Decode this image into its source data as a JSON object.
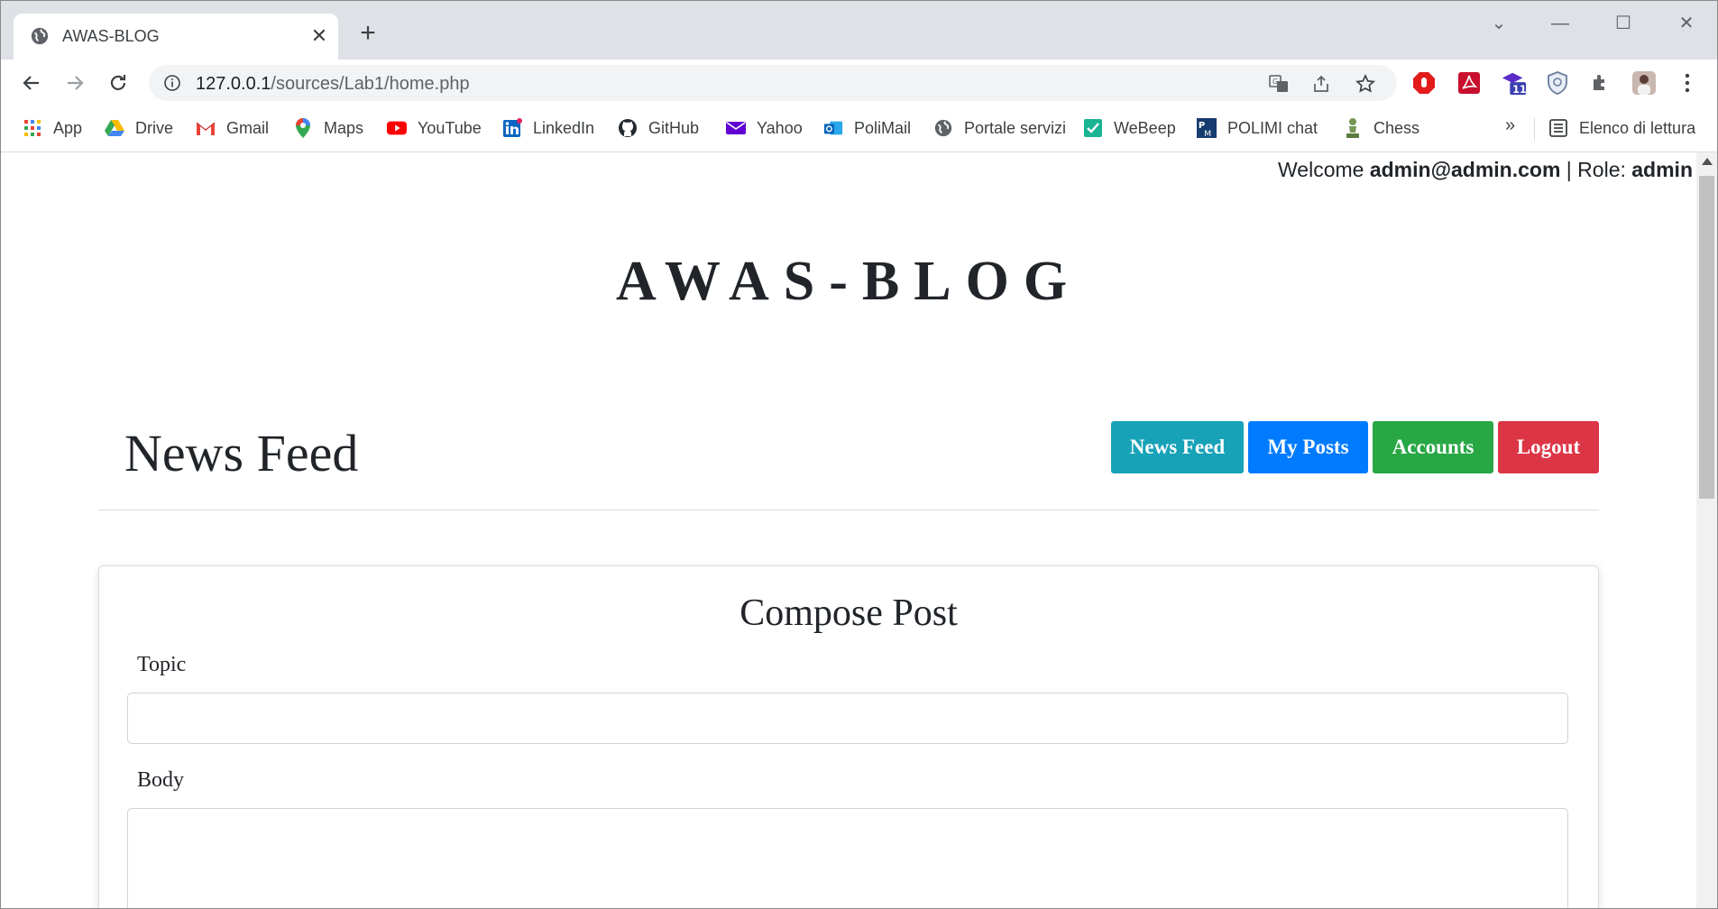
{
  "browser": {
    "tab_title": "AWAS-BLOG",
    "url_host": "127.0.0.1",
    "url_path": "/sources/Lab1/home.php",
    "extension_badge": "11"
  },
  "bookmarks": [
    {
      "label": "App",
      "icon": "apps-grid-icon"
    },
    {
      "label": "Drive",
      "icon": "drive-icon"
    },
    {
      "label": "Gmail",
      "icon": "gmail-icon"
    },
    {
      "label": "Maps",
      "icon": "maps-icon"
    },
    {
      "label": "YouTube",
      "icon": "youtube-icon"
    },
    {
      "label": "LinkedIn",
      "icon": "linkedin-icon"
    },
    {
      "label": "GitHub",
      "icon": "github-icon"
    },
    {
      "label": "Yahoo",
      "icon": "yahoo-icon"
    },
    {
      "label": "PoliMail",
      "icon": "outlook-icon"
    },
    {
      "label": "Portale servizi",
      "icon": "globe-icon"
    },
    {
      "label": "WeBeep",
      "icon": "webeep-icon"
    },
    {
      "label": "POLIMI chat",
      "icon": "polimi-icon"
    },
    {
      "label": "Chess",
      "icon": "chess-pawn-icon"
    }
  ],
  "bookmarks_more": "»",
  "reading_list": "Elenco di lettura",
  "page": {
    "welcome_prefix": "Welcome ",
    "user_email": "admin@admin.com",
    "role_prefix": " | Role: ",
    "role": "admin",
    "site_title": "AWAS-BLOG",
    "feed_title": "News Feed",
    "nav": {
      "news_feed": "News Feed",
      "my_posts": "My Posts",
      "accounts": "Accounts",
      "logout": "Logout"
    },
    "compose": {
      "heading": "Compose Post",
      "topic_label": "Topic",
      "topic_value": "",
      "body_label": "Body",
      "body_value": ""
    }
  },
  "colors": {
    "news_feed_btn": "#17a2b8",
    "my_posts_btn": "#007bff",
    "accounts_btn": "#28a745",
    "logout_btn": "#dc3545"
  }
}
